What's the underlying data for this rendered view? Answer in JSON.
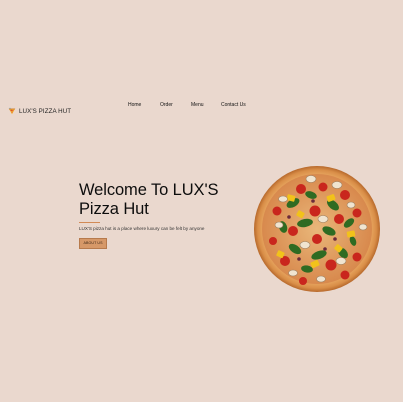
{
  "brand": {
    "name": "LUX'S PIZZA HUT",
    "logo_icon": "pizza-slice-icon"
  },
  "nav": {
    "items": [
      {
        "label": "Home"
      },
      {
        "label": "Order"
      },
      {
        "label": "Menu"
      },
      {
        "label": "Contact Us"
      }
    ]
  },
  "hero": {
    "title_line1": "Welcome To LUX'S",
    "title_line2": "Pizza Hut",
    "tagline": "LUX'S pizza hut is a place where luxury can be felt by anyone",
    "button_label": "ABOUT US",
    "image": "pizza-image"
  },
  "colors": {
    "background": "#ead8ce",
    "accent": "#d69868",
    "rule": "#d28a55"
  }
}
